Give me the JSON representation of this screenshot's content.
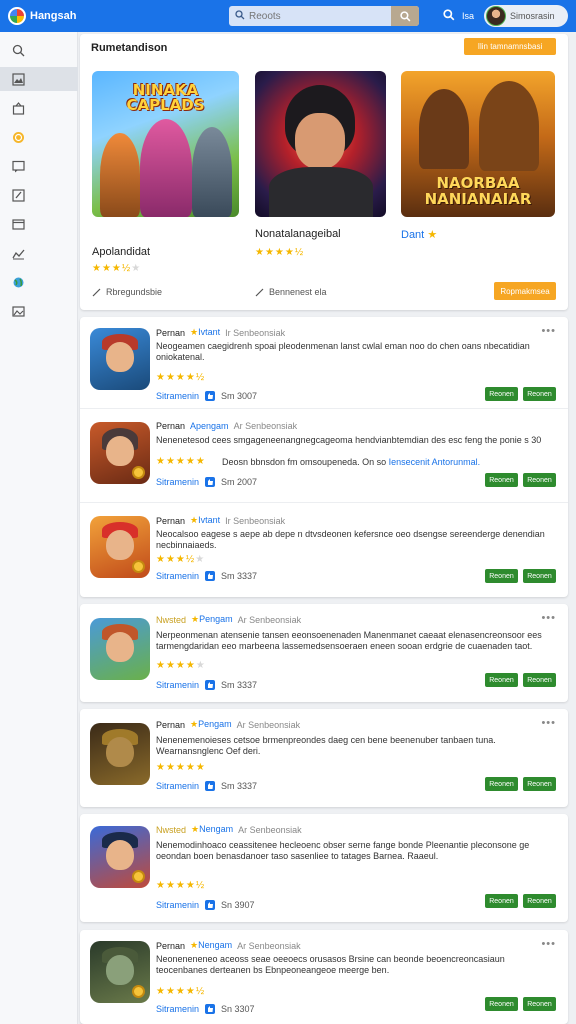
{
  "header": {
    "brand": "Hangsah",
    "search_placeholder": "Reoots",
    "top_label": "Isa",
    "user_name": "Simosrasin",
    "colors": {
      "bar": "#1a73e8",
      "accent": "#f6a623",
      "action": "#2e8b2e"
    }
  },
  "sidebar": {
    "items": [
      {
        "icon": "search-icon"
      },
      {
        "icon": "image-icon"
      },
      {
        "icon": "store-icon"
      },
      {
        "icon": "coin-icon"
      },
      {
        "icon": "chat-icon"
      },
      {
        "icon": "edit-icon"
      },
      {
        "icon": "window-icon"
      },
      {
        "icon": "chart-icon"
      },
      {
        "icon": "globe-icon"
      },
      {
        "icon": "photo-icon"
      }
    ]
  },
  "featured": {
    "title": "Rumetandison",
    "top_button": "Ilin tamnamnsbasi",
    "bottom_button": "Ropmakmsea",
    "games": [
      {
        "art_text": "NINAKA CAPLADS",
        "name": "Apolandidat",
        "rating": 3.5,
        "meta": "Rbregundsbie"
      },
      {
        "art_text": "",
        "name": "Nonatalanageibal",
        "rating": 4.5,
        "meta": "Bennenest ela"
      },
      {
        "art_text": "NAORBAA NANIANAIAR",
        "name": "Dant",
        "rating": null,
        "meta": ""
      }
    ]
  },
  "games": [
    {
      "author": "Pernan",
      "tag": "Ivtant",
      "tag_star": true,
      "time": "Ir Senbeonsiak",
      "desc": "Neogeamen caegidrenh spoai pleodenmenan lanst cwlal eman noo do chen oans nbecatidian oniokatenal.",
      "rating": 4.5,
      "user": "Sitramenin",
      "count": "Sm 3007",
      "actions": [
        "Reonen",
        "Reonen"
      ]
    },
    {
      "author": "Pernan",
      "tag": "Apengam",
      "tag_star": false,
      "time": "Ar Senbeonsiak",
      "desc": "Nenenetesod cees smgageneenangnegcageoma hendvianbtemdian des esc feng the ponie s 30",
      "desc2": "Deosn bbnsdon fm omsoupeneda. On so ",
      "link": "Iensecenit Antorunmal.",
      "rating": 5,
      "user": "Sitramenin",
      "count": "Sm 2007",
      "actions": [
        "Reonen",
        "Reonen"
      ]
    },
    {
      "author": "Pernan",
      "tag": "Ivtant",
      "tag_star": true,
      "time": "Ir Senbeonsiak",
      "desc": "Neocalsoo eagese s aepe ab depe n dtvsdeonen kefersnce oeo dsengse sereenderge denendian necbinnaiaeds.",
      "rating": 3.5,
      "user": "Sitramenin",
      "count": "Sm 3337",
      "actions": [
        "Reonen",
        "Reonen"
      ]
    },
    {
      "author": "Nwsted",
      "tag": "Pengam",
      "tag_star": true,
      "time": "Ar Senbeonsiak",
      "desc": "Nerpeonmenan atensenie tansen eeonsoenenaden Manenmanet caeaat elenasencreonsoor ees tarmengdaridan eeo marbeena lassemedsensoeraen eneen sooan erdgrie de cuaenaden taot.",
      "rating": 4,
      "user": "Sitramenin",
      "count": "Sm 3337",
      "actions": [
        "Reonen",
        "Reonen"
      ]
    },
    {
      "author": "Pernan",
      "tag": "Pengam",
      "tag_star": true,
      "time": "Ar Senbeonsiak",
      "desc": "Nenenemenoieses cetsoe brmenpreondes daeg cen bene beenenuber tanbaen tuna. Wearnansnglenc Oef deri.",
      "rating": 5,
      "user": "Sitramenin",
      "count": "Sm 3337",
      "actions": [
        "Reonen",
        "Reonen"
      ]
    },
    {
      "author": "Nwsted",
      "tag": "Nengam",
      "tag_star": true,
      "time": "Ar Senbeonsiak",
      "desc": "Nenemodinhoaco ceassitenee hecleoenc obser serne fange bonde Pleenantie pleconsone ge oeondan boen benasdanoer taso sasenliee to tatages Barnea. Raaeul.",
      "rating": 4.5,
      "user": "Sitramenin",
      "count": "Sn 3907",
      "actions": [
        "Reonen",
        "Reonen"
      ]
    },
    {
      "author": "Pernan",
      "tag": "Nengam",
      "tag_star": true,
      "time": "Ar Senbeonsiak",
      "desc": "Neoneneneneo aceoss seae oeeoecs orusasos Brsine can beonde beoencreoncasiaun teocenbanes derteanen bs Ebnpeoneangeoe meerge ben.",
      "rating": 4.5,
      "user": "Sitramenin",
      "count": "Sn 3307",
      "actions": [
        "Reonen",
        "Reonen"
      ]
    }
  ]
}
